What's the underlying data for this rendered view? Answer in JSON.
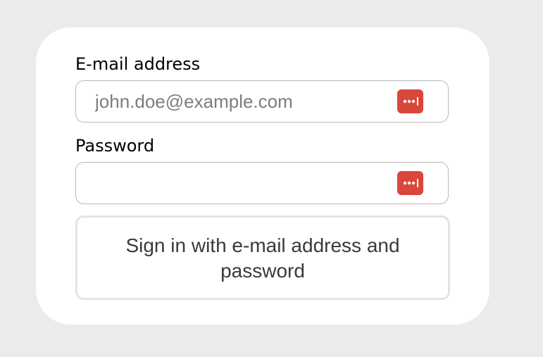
{
  "form": {
    "email_label": "E-mail address",
    "email_value": "",
    "email_placeholder": "john.doe@example.com",
    "password_label": "Password",
    "password_value": "",
    "password_placeholder": "",
    "signin_button_label": "Sign in with e-mail address and password"
  },
  "icons": {
    "password_manager_icon": "password-manager-icon",
    "password_manager_color": "#d9463b"
  },
  "colors": {
    "background": "#ebebeb",
    "card": "#ffffff",
    "field_border": "#b9b9b9",
    "button_border": "#e3e3e3"
  }
}
